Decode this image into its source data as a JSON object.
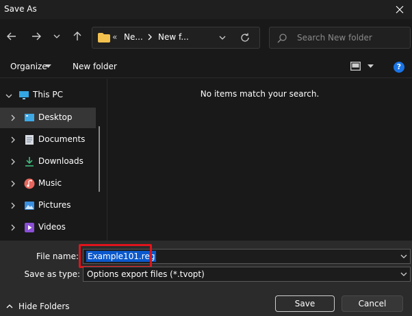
{
  "window": {
    "title": "Save As"
  },
  "address": {
    "overflow": "«",
    "crumb1": "Ne...",
    "crumb2": "New f..."
  },
  "search": {
    "placeholder": "Search New folder"
  },
  "toolbar": {
    "organize": "Organize",
    "new_folder": "New folder",
    "help": "?"
  },
  "nav": {
    "items": [
      {
        "label": "This PC",
        "icon": "monitor-icon"
      },
      {
        "label": "Desktop",
        "icon": "desktop-icon"
      },
      {
        "label": "Documents",
        "icon": "document-icon"
      },
      {
        "label": "Downloads",
        "icon": "download-icon"
      },
      {
        "label": "Music",
        "icon": "music-icon"
      },
      {
        "label": "Pictures",
        "icon": "pictures-icon"
      },
      {
        "label": "Videos",
        "icon": "videos-icon"
      }
    ]
  },
  "content": {
    "empty_message": "No items match your search."
  },
  "form": {
    "file_name_label": "File name:",
    "file_name_value": "Example101.reg",
    "save_type_label": "Save as type:",
    "save_type_value": "Options export files (*.tvopt)"
  },
  "footer": {
    "hide_folders": "Hide Folders",
    "save": "Save",
    "cancel": "Cancel"
  },
  "colors": {
    "accent": "#0a58cc",
    "highlight_box": "#e0141b",
    "help": "#1a74e6"
  }
}
